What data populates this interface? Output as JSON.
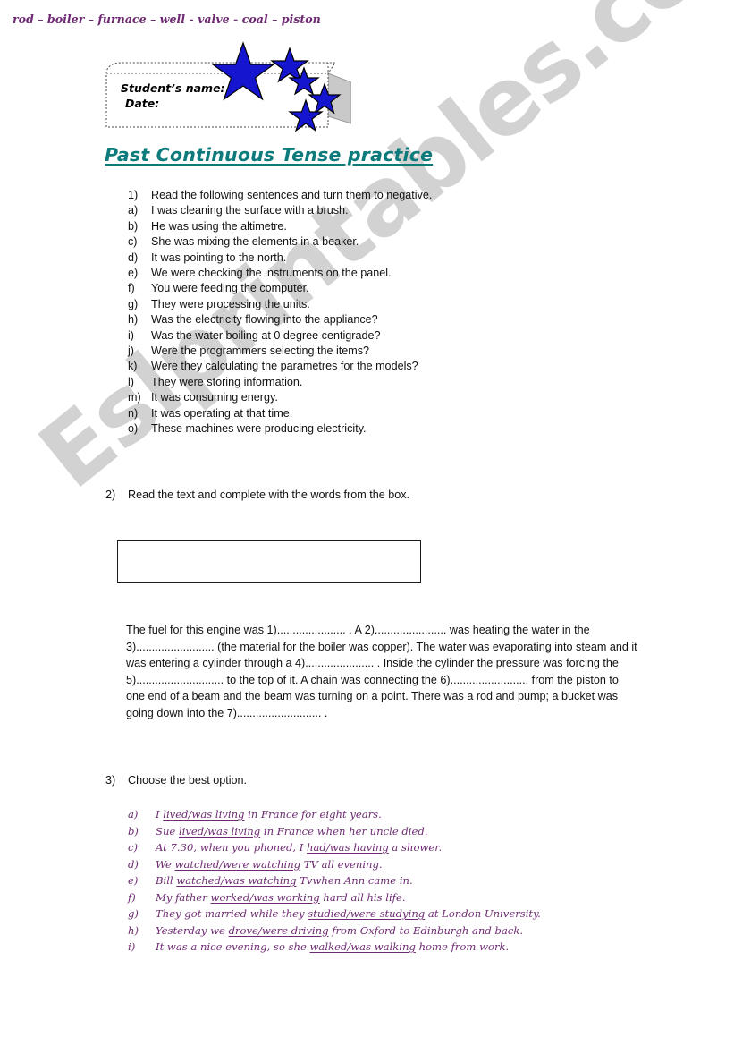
{
  "watermark": {
    "text": "Eslprintables.com",
    "color": "#d2d2d2"
  },
  "header": {
    "student_name_label": "Student’s name:",
    "date_label": "Date:",
    "star_color": "#1515d0",
    "star_count": 5
  },
  "title": {
    "text": "Past Continuous Tense practice",
    "color": "#0d7b7b"
  },
  "section1": {
    "marker": "1)",
    "instruction": "Read the following sentences and turn them to negative.",
    "items": [
      {
        "marker": "a)",
        "text": "I was cleaning the surface with a brush."
      },
      {
        "marker": "b)",
        "text": "He was using the altimetre."
      },
      {
        "marker": "c)",
        "text": "She was mixing the elements in a beaker."
      },
      {
        "marker": "d)",
        "text": "It was pointing to the north."
      },
      {
        "marker": "e)",
        "text": "We were checking the instruments on the panel."
      },
      {
        "marker": "f)",
        "text": "You were feeding the computer."
      },
      {
        "marker": "g)",
        "text": "They were processing the units."
      },
      {
        "marker": "h)",
        "text": "Was the electricity flowing into the appliance?"
      },
      {
        "marker": "i)",
        "text": "Was the water boiling at 0 degree centigrade?"
      },
      {
        "marker": "j)",
        "text": "Were the programmers selecting the items?"
      },
      {
        "marker": "k)",
        "text": "Were they calculating the parametres for the models?"
      },
      {
        "marker": "l)",
        "text": "They were storing information."
      },
      {
        "marker": "m)",
        "text": "It was consuming energy."
      },
      {
        "marker": "n)",
        "text": "It was operating at that time."
      },
      {
        "marker": "o)",
        "text": "These machines were producing electricity."
      }
    ]
  },
  "section2": {
    "marker": "2)",
    "instruction": "Read the text and complete with the words from the box.",
    "wordbox": {
      "text": "rod – boiler – furnace – well -  valve -  coal – piston",
      "color": "#6d2a72",
      "words": [
        "rod",
        "boiler",
        "furnace",
        "well",
        "valve",
        "coal",
        "piston"
      ]
    },
    "gapfill_text": "The fuel for this engine was 1)...................... . A 2)....................... was heating the water in the 3)......................... (the material for the boiler was copper). The water was evaporating into steam and it was entering a cylinder through a 4)...................... . Inside the cylinder the pressure was forcing the 5)............................ to the top of it. A chain was connecting the 6)......................... from the piston to one end of a beam and the beam was turning on a point. There was a rod and pump; a bucket was going down into the 7)........................... ."
  },
  "section3": {
    "marker": "3)",
    "instruction": "Choose the best option.",
    "color": "#6d2a72",
    "items": [
      {
        "marker": "a)",
        "before": "I ",
        "choice": "lived/was living",
        "after": " in France for eight years."
      },
      {
        "marker": "b)",
        "before": "Sue ",
        "choice": "lived/was living",
        "after": " in France when her uncle died."
      },
      {
        "marker": "c)",
        "before": "At 7.30, when you phoned, I ",
        "choice": "had/was having",
        "after": " a shower."
      },
      {
        "marker": "d)",
        "before": "We ",
        "choice": "watched/were watching",
        "after": " TV all evening."
      },
      {
        "marker": "e)",
        "before": "Bill ",
        "choice": "watched/was watching",
        "after": " Tvwhen Ann came in."
      },
      {
        "marker": "f)",
        "before": "My father ",
        "choice": "worked/was working",
        "after": " hard all his life."
      },
      {
        "marker": "g)",
        "before": "They got married while they ",
        "choice": "studied/were studying",
        "after": " at London University."
      },
      {
        "marker": "h)",
        "before": "Yesterday we ",
        "choice": "drove/were driving",
        "after": " from Oxford to Edinburgh and back."
      },
      {
        "marker": "i)",
        "before": "It was a nice evening, so she ",
        "choice": "walked/was walking",
        "after": " home from work."
      }
    ]
  }
}
